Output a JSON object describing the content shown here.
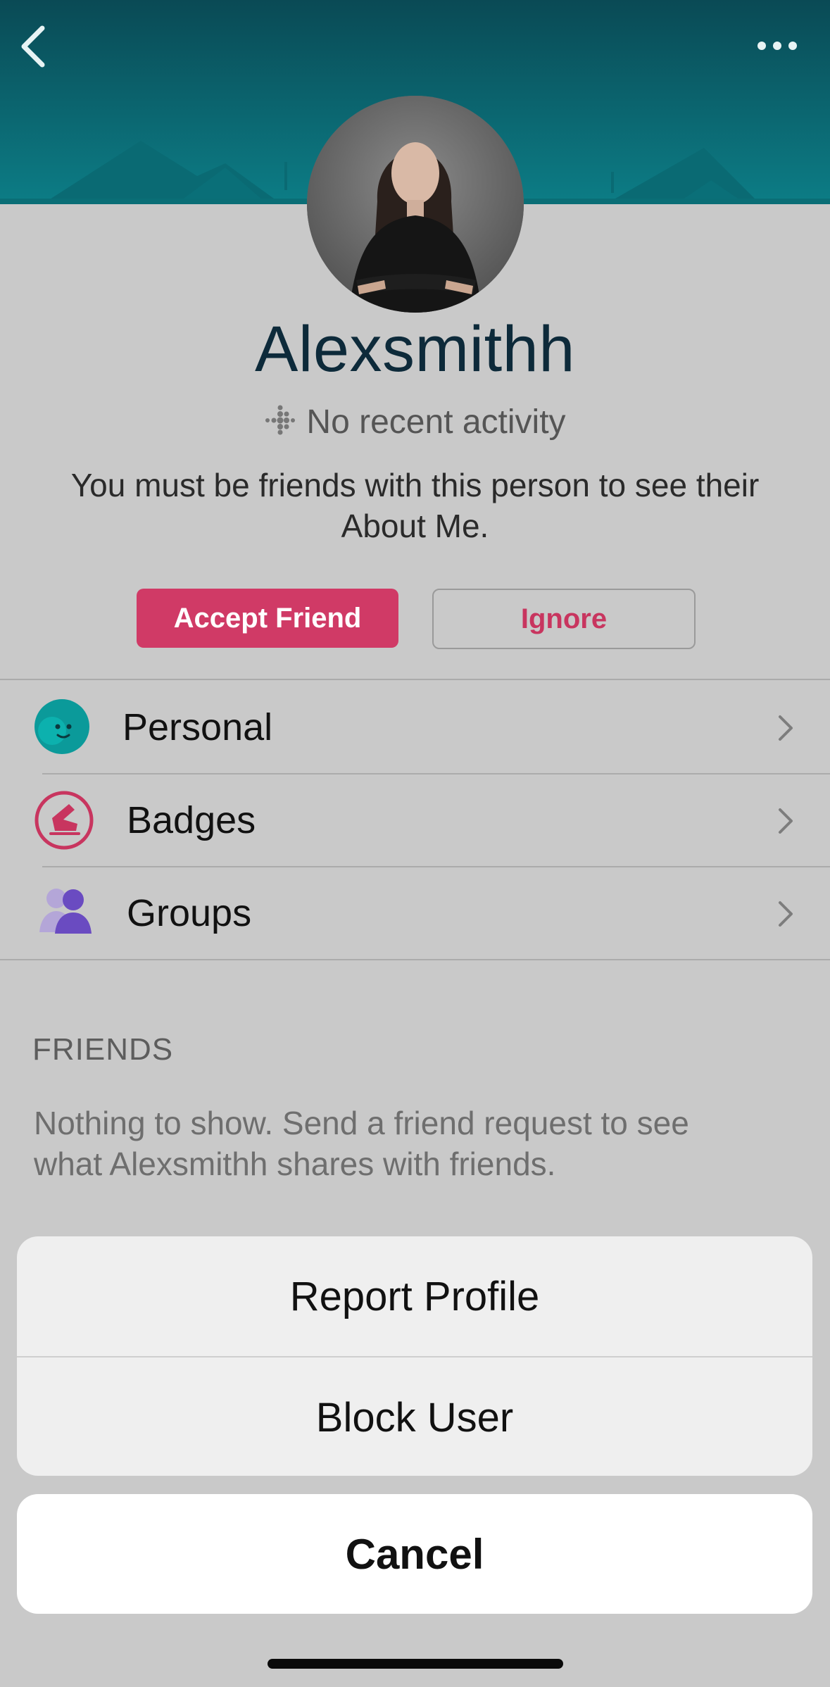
{
  "profile": {
    "username": "Alexsmithh",
    "activity": "No recent activity",
    "about_message": "You must be friends with this person to see their About Me."
  },
  "actions": {
    "accept": "Accept Friend",
    "ignore": "Ignore"
  },
  "menu": {
    "items": [
      {
        "label": "Personal",
        "icon": "personal-face-icon"
      },
      {
        "label": "Badges",
        "icon": "badge-shoe-icon"
      },
      {
        "label": "Groups",
        "icon": "groups-people-icon"
      }
    ]
  },
  "friends": {
    "title": "FRIENDS",
    "message": "Nothing to show. Send a friend request to see what Alexsmithh shares with friends."
  },
  "action_sheet": {
    "report": "Report Profile",
    "block": "Block User",
    "cancel": "Cancel"
  },
  "colors": {
    "accent": "#d03a66",
    "header": "#0c7d86",
    "overlay": "#c9c9c9"
  }
}
